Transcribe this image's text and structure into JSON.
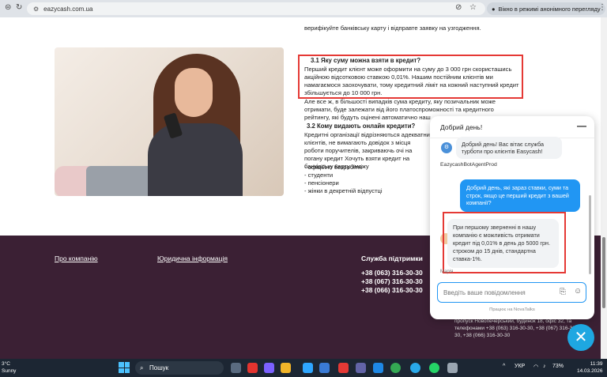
{
  "browser": {
    "url": "eazycash.com.ua",
    "incognito_label": "Вікно в режимі анонімного перегляду"
  },
  "article": {
    "top_line": "верифікуйте банківську карту і відправте заявку на узгодження.",
    "h1": "3.1 Яку суму можна взяти в кредит?",
    "p1": "Перший кредит клієнт може оформити на суму до 3 000 грн скористашись акційною відсотковою ставкою 0,01%. Нашим постійним клієнтів ми намагаємося заохочувати, тому кредитний ліміт на кожний наступний кредит збільшується до 10 000 грн.",
    "p2": "Але все ж, в більшості випадків сума кредиту, яку позичальник може отримати, буде залежати від його платоспроможності та кредитного рейтингу, які будуть оцінені автоматично наш",
    "h2": "3.2 Кому видають онлайн кредити?",
    "p3": "Кредитні організації відрізняються адекватни клієнтів, не вимагають довідок з місця роботи поручителів, закриваючь очі на погану кредит Хочуть взяти кредит на банківську карту зможу",
    "list": [
      "- офіційно безробітні",
      "- студенти",
      "- пенсіонери",
      "- жінки в декретній відпустці"
    ]
  },
  "footer": {
    "about": "Про компанію",
    "legal": "Юридична інформація",
    "support_title": "Служба підтримки",
    "phones": [
      "+38 (063) 316-30-30",
      "+38 (067) 316-30-30",
      "+38 (066) 316-30-30"
    ],
    "address": "пропуск Новопечерський, будинок 18, офіс 32, та телефонами +38 (063) 316-30-30, +38 (067) 316-30-30, +38 (066) 316-30-30"
  },
  "chat": {
    "header_title": "Добрий день!",
    "bot_message": "Добрий день! Вас вітає служба турботи про клієнтів Easycash!",
    "agent_name": "EazycashBotAgentProd",
    "user_message": "Добрий день, які зараз ставки, суми та строк, якщо це перший кредит з вашей компанії?",
    "agent_message": "При першому зверненні в нашу компанію є можливість отримати кредит під 0,01% в день до 5000 грн. строком до 15 днів, стандартна ставка-1%.",
    "agent_sign": "Марія",
    "input_placeholder": "Введіть ваше повідомлення",
    "powered": "Працює на NovaTalks"
  },
  "taskbar": {
    "weather_temp": "3°C",
    "weather_desc": "Sunny",
    "search_label": "Пошук",
    "lang": "УКР",
    "battery": "73%",
    "time": "11:39",
    "date": "14.03.2026"
  },
  "colors": {
    "footer_bg": "#3b2034",
    "chat_user_bubble": "#2196f3",
    "highlight_red": "#e53935",
    "fab": "#1ea7e1"
  }
}
